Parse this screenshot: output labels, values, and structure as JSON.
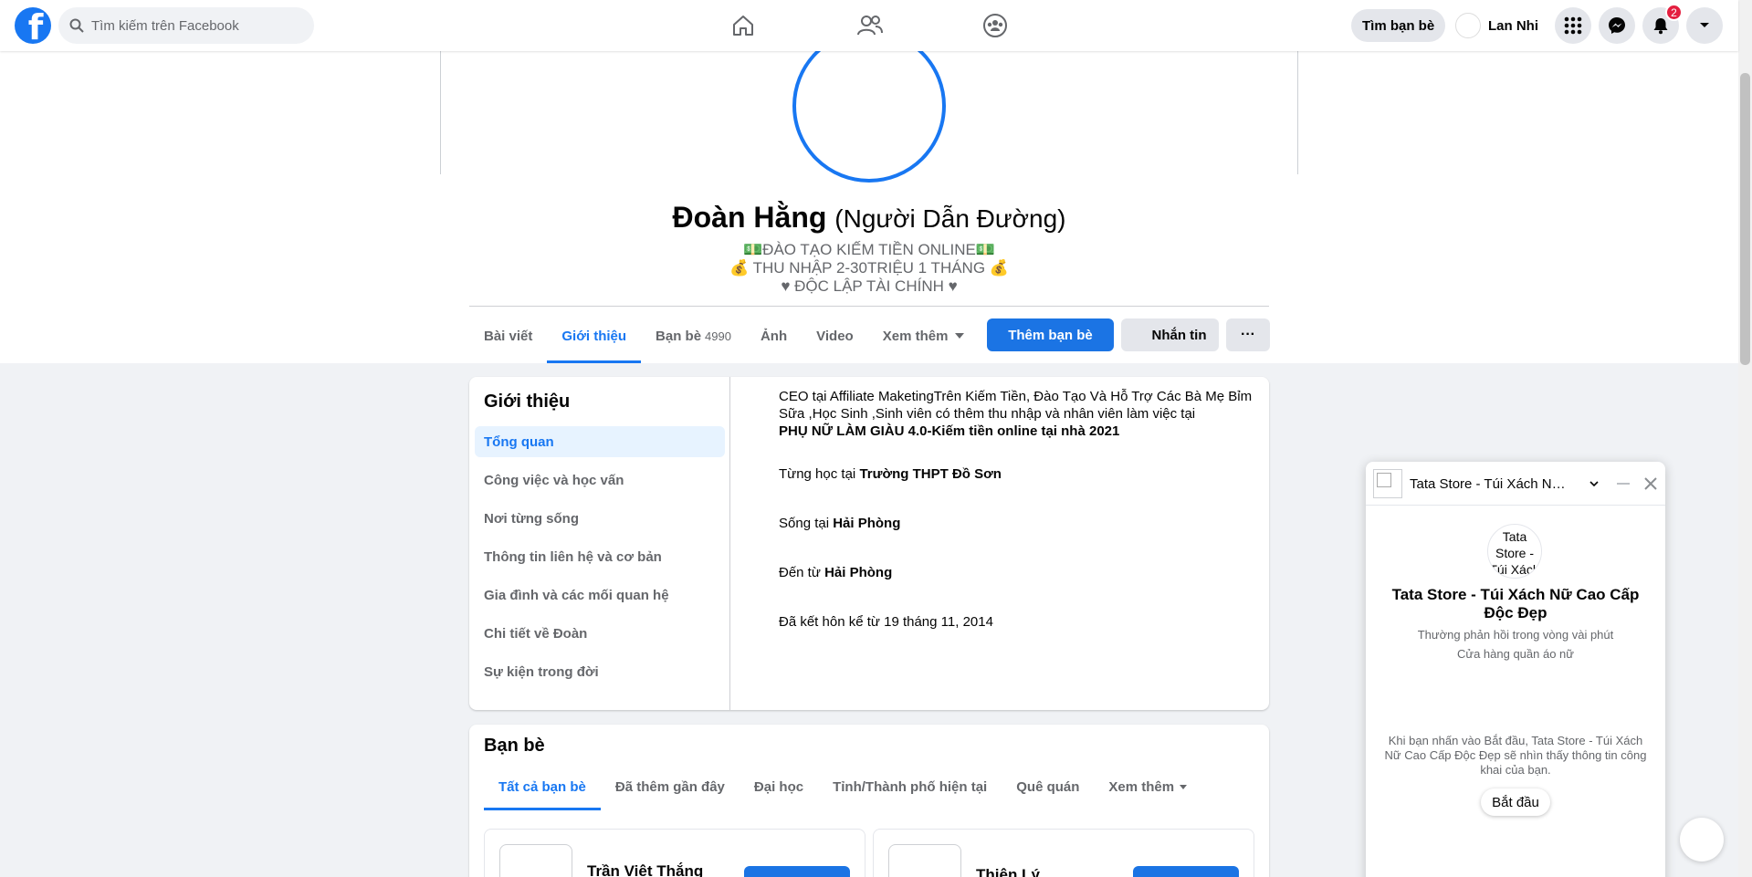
{
  "topbar": {
    "search_placeholder": "Tìm kiếm trên Facebook",
    "find_friends": "Tìm bạn bè",
    "user_name": "Lan Nhi",
    "notification_count": "2",
    "nav_icons": [
      "home-icon",
      "friends-icon",
      "groups-icon"
    ]
  },
  "profile": {
    "name": "Đoàn Hằng",
    "alt_name": "(Người Dẫn Đường)",
    "bio": [
      "💵ĐÀO TẠO KIẾM TIỀN ONLINE💵",
      "💰 THU NHẬP 2-30TRIỆU 1 THÁNG 💰",
      "♥ ĐỘC LẬP TÀI CHÍNH ♥"
    ]
  },
  "tabs": [
    {
      "label": "Bài viết"
    },
    {
      "label": "Giới thiệu",
      "active": true
    },
    {
      "label": "Bạn bè",
      "count": "4990"
    },
    {
      "label": "Ảnh"
    },
    {
      "label": "Video"
    },
    {
      "label": "Xem thêm"
    }
  ],
  "actions": {
    "add_friend": "Thêm bạn bè",
    "message": "Nhắn tin",
    "more": "···"
  },
  "intro": {
    "title": "Giới thiệu",
    "menu": [
      "Tổng quan",
      "Công việc và học vấn",
      "Nơi từng sống",
      "Thông tin liên hệ và cơ bản",
      "Gia đình và các mối quan hệ",
      "Chi tiết về Đoàn",
      "Sự kiện trong đời"
    ],
    "work_prefix": "CEO tại Affiliate MaketingTrên Kiếm Tiền, Đào Tạo Và Hỗ Trợ Các Bà Mẹ Bỉm Sữa ,Học Sinh ,Sinh viên có thêm thu nhập và nhân viên làm việc tại",
    "work_place": "PHỤ NỮ LÀM GIÀU 4.0-Kiếm tiền online tại nhà 2021",
    "school_prefix": "Từng học tại",
    "school": "Trường THPT Đồ Sơn",
    "lives_prefix": "Sống tại",
    "lives": "Hải Phòng",
    "from_prefix": "Đến từ",
    "from": "Hải Phòng",
    "married": "Đã kết hôn kể từ 19 tháng 11, 2014"
  },
  "friends": {
    "title": "Bạn bè",
    "tabs": [
      "Tất cả bạn bè",
      "Đã thêm gần đây",
      "Đại học",
      "Tỉnh/Thành phố hiện tại",
      "Quê quán",
      "Xem thêm"
    ],
    "list": [
      {
        "name": "Trần Việt Thắng"
      },
      {
        "name": "Thiện Lý"
      }
    ]
  },
  "chat": {
    "header_name": "Tata Store - Túi Xách Nữ Cao Cấp Độc Đẹp",
    "avatar_alt": "Tata Store - Túi Xách",
    "title": "Tata Store - Túi Xách Nữ Cao Cấp Độc Đẹp",
    "response": "Thường phản hồi trong vòng vài phút",
    "category": "Cửa hàng quần áo nữ",
    "info": "Khi bạn nhấn vào Bắt đầu, Tata Store - Túi Xách Nữ Cao Cấp Độc Đẹp sẽ nhìn thấy thông tin công khai của bạn.",
    "start": "Bắt đầu"
  },
  "colors": {
    "accent": "#1877f2",
    "badge": "#e41e3f"
  }
}
